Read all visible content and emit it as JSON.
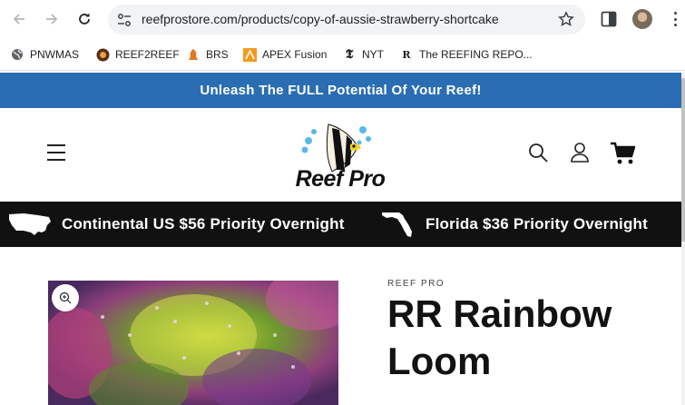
{
  "browser": {
    "url": "reefprostore.com/products/copy-of-aussie-strawberry-shortcake",
    "bookmarks": [
      {
        "label": "PNWMAS",
        "icon": "globe-icon"
      },
      {
        "label": "REEF2REEF",
        "icon": "reef2reef-icon"
      },
      {
        "label": "BRS",
        "icon": "brs-icon"
      },
      {
        "label": "APEX Fusion",
        "icon": "apex-icon"
      },
      {
        "label": "NYT",
        "icon": "nyt-icon"
      },
      {
        "label": "The REEFING REPO...",
        "icon": "reefing-repo-icon"
      }
    ]
  },
  "announcement": "Unleash The FULL Potential Of Your Reef!",
  "header": {
    "logo_text": "Reef Pro"
  },
  "shipping": [
    {
      "label": "Continental US $56 Priority Overnight",
      "icon": "usa-map-icon"
    },
    {
      "label": "Florida $36 Priority Overnight",
      "icon": "florida-map-icon"
    }
  ],
  "product": {
    "vendor": "REEF PRO",
    "title": "RR Rainbow Loom"
  },
  "colors": {
    "announcement_bg": "#2a6db3",
    "shipbar_bg": "#111111"
  }
}
